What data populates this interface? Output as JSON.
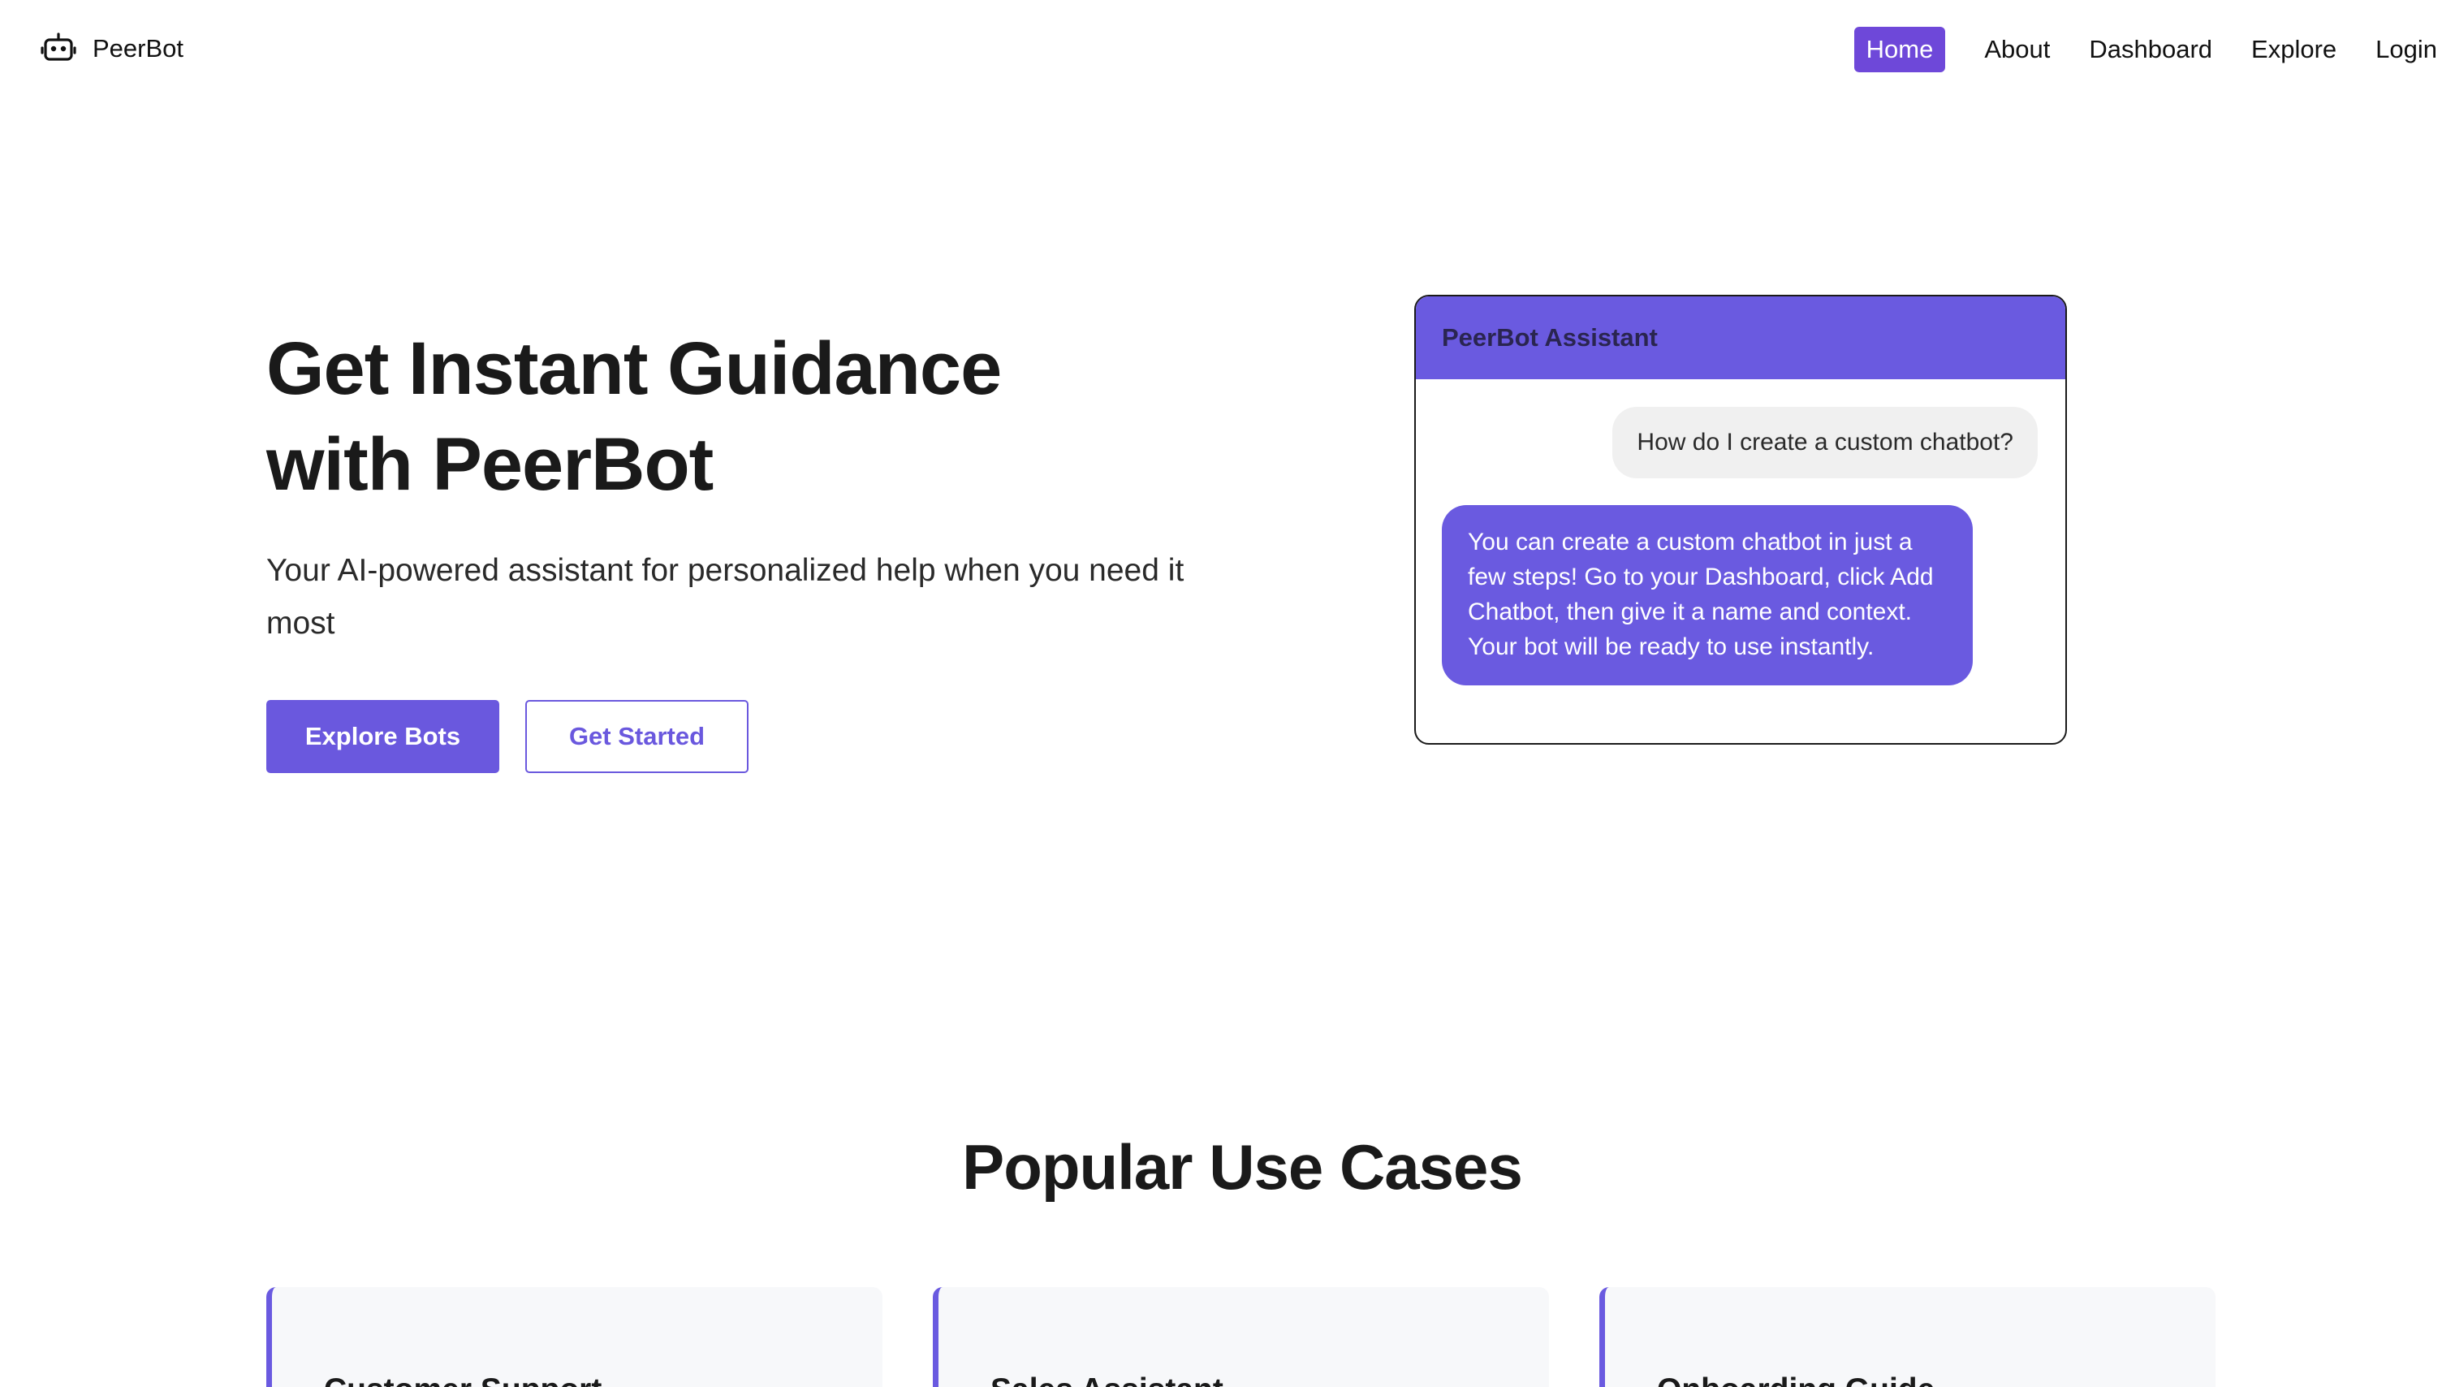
{
  "brand": {
    "name": "PeerBot",
    "icon": "robot-icon"
  },
  "nav": {
    "items": [
      {
        "label": "Home",
        "active": true
      },
      {
        "label": "About",
        "active": false
      },
      {
        "label": "Dashboard",
        "active": false
      },
      {
        "label": "Explore",
        "active": false
      },
      {
        "label": "Login",
        "active": false
      }
    ]
  },
  "hero": {
    "title_line1": "Get Instant Guidance",
    "title_line2": "with PeerBot",
    "subtitle": "Your AI-powered assistant for personalized help when you need it most",
    "primary_button": "Explore Bots",
    "secondary_button": "Get Started"
  },
  "chat": {
    "header": "PeerBot Assistant",
    "user_message": "How do I create a custom chatbot?",
    "bot_message": "You can create a custom chatbot in just a few steps! Go to your Dashboard, click Add Chatbot, then give it a name and context. Your bot will be ready to use instantly."
  },
  "use_cases": {
    "title": "Popular Use Cases",
    "cards": [
      {
        "title": "Customer Support"
      },
      {
        "title": "Sales Assistant"
      },
      {
        "title": "Onboarding Guide"
      }
    ]
  },
  "colors": {
    "accent": "#6a5ae0",
    "nav_active": "#6e48d9",
    "card_bg": "#f7f8fa"
  }
}
